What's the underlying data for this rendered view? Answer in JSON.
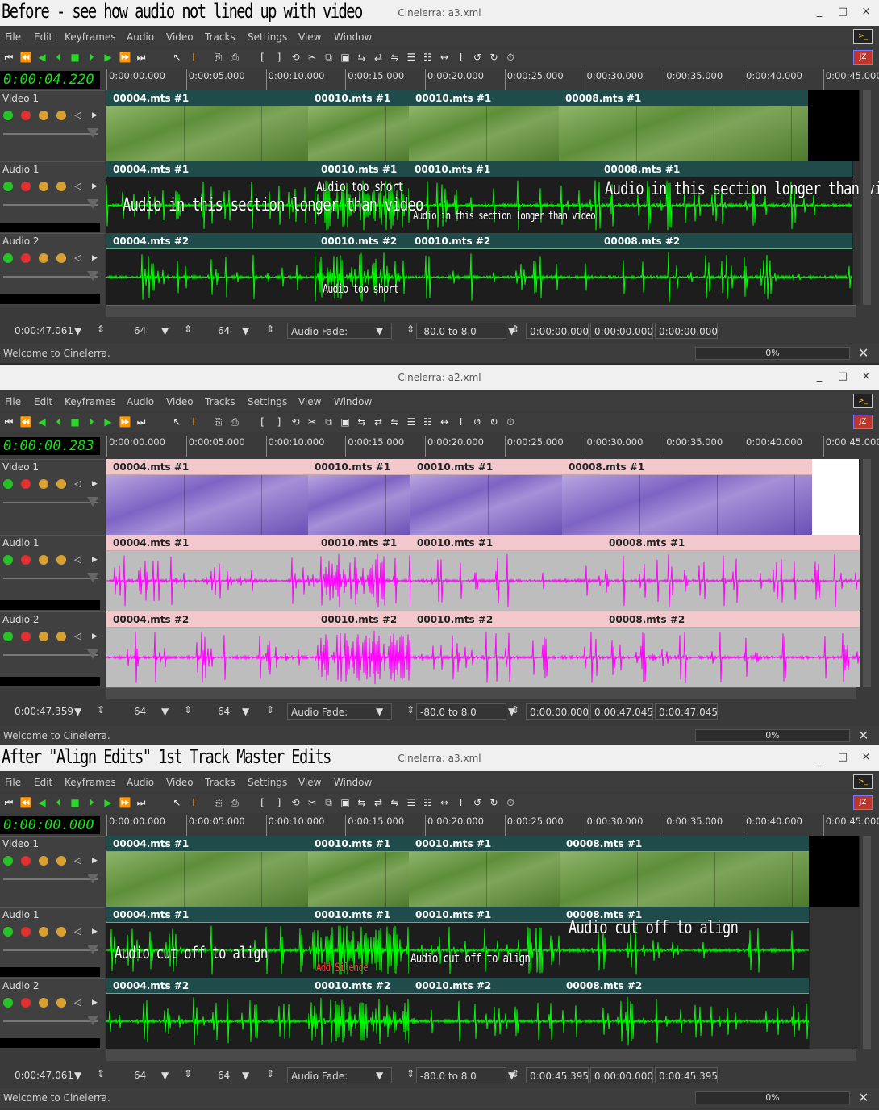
{
  "windows": [
    {
      "caption": "Before - see how audio not lined up with video",
      "title": "Cinelerra: a3.xml",
      "theme": "green",
      "clock": "0:00:04.220",
      "status_time": "0:00:47.061",
      "selection": [
        "0:00:00.000",
        "0:00:00.000",
        "0:00:00.000"
      ],
      "progress": "0%",
      "video_edits": [
        "00004.mts #1",
        "00010.mts #1",
        "00010.mts #1",
        "00008.mts #1"
      ],
      "audio1_edits": [
        "00004.mts #1",
        "00010.mts #1",
        "00010.mts #1",
        "00008.mts #1"
      ],
      "audio2_edits": [
        "00004.mts #2",
        "00010.mts #2",
        "00010.mts #2",
        "00008.mts #2"
      ],
      "annotations": {
        "a1_left": "Audio in this section longer than video",
        "a1_mid": "Audio too short",
        "a1_mid2": "Audio in this section longer than video",
        "a1_right": "Audio in this section longer than video",
        "a2_mid": "Audio too short"
      }
    },
    {
      "caption": "",
      "title": "Cinelerra: a2.xml",
      "theme": "pink",
      "clock": "0:00:00.283",
      "status_time": "0:00:47.359",
      "selection": [
        "0:00:00.000",
        "0:00:47.045",
        "0:00:47.045"
      ],
      "progress": "0%",
      "video_edits": [
        "00004.mts #1",
        "00010.mts #1",
        "00010.mts #1",
        "00008.mts #1"
      ],
      "audio1_edits": [
        "00004.mts #1",
        "00010.mts #1",
        "00010.mts #1",
        "00008.mts #1"
      ],
      "audio2_edits": [
        "00004.mts #2",
        "00010.mts #2",
        "00010.mts #2",
        "00008.mts #2"
      ],
      "annotations": {}
    },
    {
      "caption": "After \"Align Edits\" 1st Track Master Edits",
      "title": "Cinelerra: a3.xml",
      "theme": "green",
      "clock": "0:00:00.000",
      "status_time": "0:00:47.061",
      "selection": [
        "0:00:45.395",
        "0:00:00.000",
        "0:00:45.395"
      ],
      "progress": "0%",
      "video_edits": [
        "00004.mts #1",
        "00010.mts #1",
        "00010.mts #1",
        "00008.mts #1"
      ],
      "audio1_edits": [
        "00004.mts #1",
        "00010.mts #1",
        "00010.mts #1",
        "00008.mts #1"
      ],
      "audio2_edits": [
        "00004.mts #2",
        "00010.mts #2",
        "00010.mts #2",
        "00008.mts #2"
      ],
      "annotations": {
        "a1_left": "Audio cut off to align",
        "a1_mid": "Add Silence",
        "a1_mid2": "Audio cut off to align",
        "a1_right": "Audio cut off to align"
      }
    }
  ],
  "menu": [
    "File",
    "Edit",
    "Keyframes",
    "Audio",
    "Video",
    "Tracks",
    "Settings",
    "View",
    "Window"
  ],
  "tracks": [
    "Video 1",
    "Audio 1",
    "Audio 2"
  ],
  "ruler_labels": [
    "0:00:00.000",
    "0:00:05.000",
    "0:00:10.000",
    "0:00:15.000",
    "0:00:20.000",
    "0:00:25.000",
    "0:00:30.000",
    "0:00:35.000",
    "0:00:40.000",
    "0:00:45.000"
  ],
  "status": {
    "zoom1": "64",
    "zoom2": "64",
    "fade_label": "Audio Fade:",
    "range": "-80.0 to 8.0",
    "welcome": "Welcome to Cinelerra."
  },
  "window_controls": [
    "_",
    "□",
    "×"
  ],
  "colors": {
    "green_wave": "#00ff00",
    "pink_wave": "#ff00ff",
    "clock_text": "#18e018",
    "edit_header_green": "#1f4b4b",
    "edit_header_pink": "#f2c8cc"
  }
}
